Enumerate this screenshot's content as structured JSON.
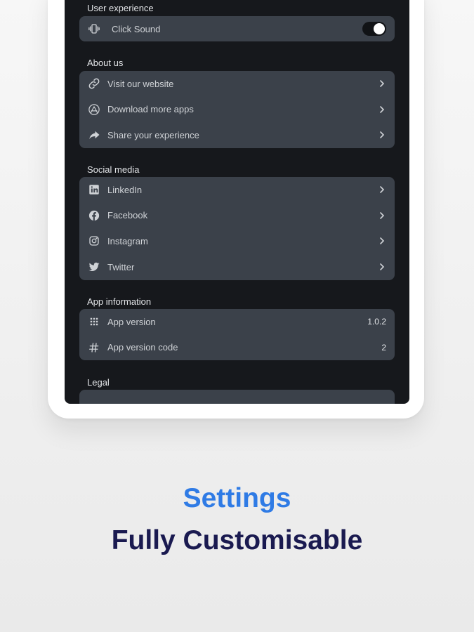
{
  "colors": {
    "accent": "#2f7be5",
    "headline_dark": "#1a1a50",
    "screen_bg": "#16181c",
    "card_bg": "#3b414a"
  },
  "sections": {
    "user_experience": {
      "title": "User experience",
      "items": [
        {
          "label": "Click Sound",
          "icon": "vibration-icon",
          "toggle_on": true
        }
      ]
    },
    "about_us": {
      "title": "About us",
      "items": [
        {
          "label": "Visit our website",
          "icon": "link-icon"
        },
        {
          "label": "Download more apps",
          "icon": "app-store-icon"
        },
        {
          "label": "Share your experience",
          "icon": "share-icon"
        }
      ]
    },
    "social_media": {
      "title": "Social media",
      "items": [
        {
          "label": "LinkedIn",
          "icon": "linkedin-icon"
        },
        {
          "label": "Facebook",
          "icon": "facebook-icon"
        },
        {
          "label": "Instagram",
          "icon": "instagram-icon"
        },
        {
          "label": "Twitter",
          "icon": "twitter-icon"
        }
      ]
    },
    "app_information": {
      "title": "App information",
      "items": [
        {
          "label": "App version",
          "icon": "grid-icon",
          "value": "1.0.2"
        },
        {
          "label": "App version code",
          "icon": "hash-icon",
          "value": "2"
        }
      ]
    },
    "legal": {
      "title": "Legal"
    }
  },
  "headline": {
    "line1": "Settings",
    "line2": "Fully Customisable"
  }
}
